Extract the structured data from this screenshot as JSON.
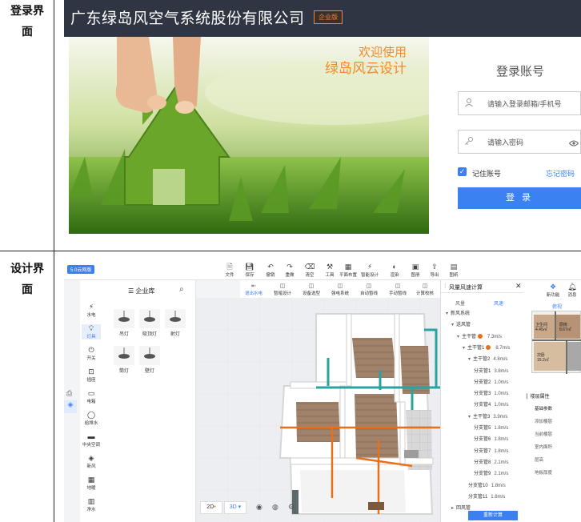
{
  "labels": {
    "login_row": [
      "登录界",
      "面"
    ],
    "design_row": [
      "设计界",
      "面"
    ]
  },
  "login": {
    "company": "广东绿岛风空气系统股份有限公司",
    "edition_badge": "企业版",
    "welcome_line1": "欢迎使用",
    "welcome_line2": "绿岛风云设计",
    "form_title": "登录账号",
    "username_placeholder": "请输入登录邮箱/手机号",
    "password_placeholder": "请输入密码",
    "remember_label": "记住账号",
    "forgot_label": "忘记密码",
    "submit_label": "登 录",
    "colors": {
      "header": "#2f3542",
      "accent": "#3b82f0",
      "orange": "#f08a2c"
    }
  },
  "design": {
    "version_badge": "5.0云网版",
    "toolbar": [
      {
        "icon": "file-icon",
        "label": "文件"
      },
      {
        "icon": "save-icon",
        "label": "保存"
      },
      {
        "icon": "undo-icon",
        "label": "撤销"
      },
      {
        "icon": "redo-icon",
        "label": "重做"
      },
      {
        "icon": "clear-icon",
        "label": "清空"
      },
      {
        "icon": "tools-icon",
        "label": "工具"
      },
      {
        "icon": "floorplan-icon",
        "label": "平面布置"
      },
      {
        "icon": "smart-icon",
        "label": "智能设计"
      },
      {
        "icon": "render-icon",
        "label": "渲染"
      },
      {
        "icon": "image-icon",
        "label": "图册"
      },
      {
        "icon": "export-icon",
        "label": "导出"
      },
      {
        "icon": "drawing-icon",
        "label": "图纸"
      }
    ],
    "subtoolbar": [
      {
        "label": "退出水电"
      },
      {
        "label": "暂暗设计"
      },
      {
        "label": "设备选型"
      },
      {
        "label": "强电系统"
      },
      {
        "label": "自动暂线"
      },
      {
        "label": "手动暂线"
      },
      {
        "label": "计算校核"
      },
      {
        "label": "图纸清单"
      }
    ],
    "library": {
      "title": "企业库",
      "categories": [
        "水电",
        "灯具",
        "开关",
        "插座",
        "电箱",
        "给排水",
        "中央空调",
        "新风",
        "地暖",
        "净水"
      ],
      "active_category": "灯具",
      "items": [
        "吊灯",
        "吸顶灯",
        "射灯",
        "筒灯",
        "壁灯"
      ]
    },
    "view_buttons": {
      "two_d": "2D",
      "three_d": "3D"
    },
    "panel": {
      "title": "风量风速计算",
      "tab_volume": "风量",
      "tab_speed": "风速",
      "rows": [
        {
          "name": "新风系统",
          "value": "",
          "indent": 0,
          "tree": "▾"
        },
        {
          "name": "送风管",
          "value": "",
          "indent": 1,
          "tree": "▾"
        },
        {
          "name": "主干管",
          "value": "7.3m/s",
          "indent": 2,
          "tree": "▾",
          "dot": true
        },
        {
          "name": "主干管1",
          "value": "8.7m/s",
          "indent": 3,
          "tree": "▾",
          "dot": true
        },
        {
          "name": "主干管2",
          "value": "4.8m/s",
          "indent": 4,
          "tree": "▾"
        },
        {
          "name": "分支管1",
          "value": "3.8m/s",
          "indent": 5
        },
        {
          "name": "分支管2",
          "value": "1.0m/s",
          "indent": 5
        },
        {
          "name": "分支管3",
          "value": "1.0m/s",
          "indent": 5
        },
        {
          "name": "分支管4",
          "value": "1.0m/s",
          "indent": 5
        },
        {
          "name": "主干管3",
          "value": "3.9m/s",
          "indent": 4,
          "tree": "▾"
        },
        {
          "name": "分支管5",
          "value": "1.8m/s",
          "indent": 5
        },
        {
          "name": "分支管6",
          "value": "1.8m/s",
          "indent": 5
        },
        {
          "name": "分支管7",
          "value": "1.8m/s",
          "indent": 5
        },
        {
          "name": "分支管8",
          "value": "2.1m/s",
          "indent": 5
        },
        {
          "name": "分支管9",
          "value": "2.1m/s",
          "indent": 5
        },
        {
          "name": "分支管10",
          "value": "1.8m/s",
          "indent": 4
        },
        {
          "name": "分支管11",
          "value": "1.8m/s",
          "indent": 4
        },
        {
          "name": "回风管",
          "value": "",
          "indent": 1,
          "tree": "▸"
        }
      ],
      "button": "重新计算"
    },
    "right": {
      "top_buttons": [
        "新功能",
        "消息"
      ],
      "view_tab": "俯视",
      "rooms": [
        {
          "name": "卫生间",
          "area": "4.45㎡"
        },
        {
          "name": "厨房",
          "area": "8.67㎡"
        },
        {
          "name": "次卧",
          "area": "15.2㎡"
        }
      ],
      "props_title": "楼层属性",
      "section": "基础参数",
      "props": [
        "添加楼层",
        "当前楼层",
        "室内面积",
        "层高",
        "地板厚度"
      ]
    },
    "colors": {
      "accent": "#3b7ff0",
      "pipe_teal": "#2aa3a3",
      "pipe_orange": "#e8701a"
    }
  }
}
